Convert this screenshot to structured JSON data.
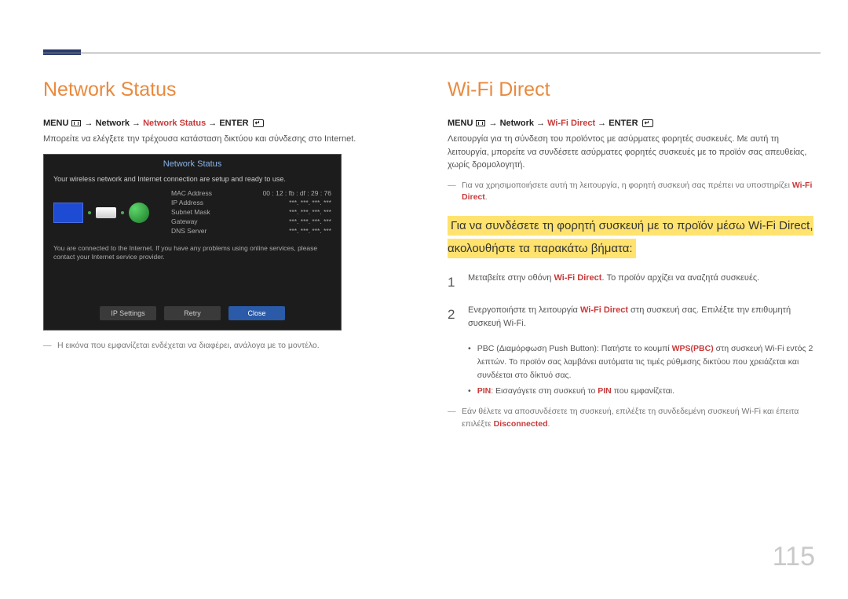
{
  "page_number": "115",
  "left": {
    "title": "Network Status",
    "menu_parts": {
      "p1": "MENU",
      "p2": "Network",
      "p3": "Network Status",
      "p4": "ENTER"
    },
    "body": "Μπορείτε να ελέγξετε την τρέχουσα κατάσταση δικτύου και σύνδεσης στο Internet.",
    "note": "Η εικόνα που εμφανίζεται ενδέχεται να διαφέρει, ανάλογα με το μοντέλο.",
    "ss": {
      "title": "Network Status",
      "msg": "Your wireless network and Internet connection are setup and ready to use.",
      "rows": {
        "r1": {
          "k": "MAC Address",
          "v": "00 : 12 : fb : df : 29 : 76"
        },
        "r2": {
          "k": "IP Address",
          "v": "***. ***. ***. ***"
        },
        "r3": {
          "k": "Subnet Mask",
          "v": "***. ***. ***. ***"
        },
        "r4": {
          "k": "Gateway",
          "v": "***. ***. ***. ***"
        },
        "r5": {
          "k": "DNS Server",
          "v": "***. ***. ***. ***"
        }
      },
      "footer": "You are connected to the Internet. If you have any problems using online services, please contact your Internet service provider.",
      "buttons": {
        "b1": "IP Settings",
        "b2": "Retry",
        "b3": "Close"
      }
    }
  },
  "right": {
    "title": "Wi-Fi Direct",
    "menu_parts": {
      "p1": "MENU",
      "p2": "Network",
      "p3": "Wi-Fi Direct",
      "p4": "ENTER"
    },
    "body": "Λειτουργία για τη σύνδεση του προϊόντος με ασύρματες φορητές συσκευές. Με αυτή τη λειτουργία, μπορείτε να συνδέσετε ασύρματες φορητές συσκευές με το προϊόν σας απευθείας, χωρίς δρομολογητή.",
    "note1_a": "Για να χρησιμοποιήσετε αυτή τη λειτουργία, η φορητή συσκευή σας πρέπει να υποστηρίζει ",
    "note1_b": "Wi-Fi Direct",
    "sub_heading": "Για να συνδέσετε τη φορητή συσκευή με το προϊόν μέσω Wi-Fi Direct, ακολουθήστε τα παρακάτω βήματα:",
    "step1_a": "Μεταβείτε στην οθόνη ",
    "step1_b": "Wi-Fi Direct",
    "step1_c": ". Το προϊόν αρχίζει να αναζητά συσκευές.",
    "step2_a": "Ενεργοποιήστε τη λειτουργία ",
    "step2_b": "Wi-Fi Direct",
    "step2_c": " στη συσκευή σας. Επιλέξτε την επιθυμητή συσκευή Wi-Fi.",
    "bullet1_a": "PBC (Διαμόρφωση Push Button): Πατήστε το κουμπί ",
    "bullet1_b": "WPS(PBC)",
    "bullet1_c": " στη συσκευή Wi-Fi εντός 2 λεπτών. Το προϊόν σας λαμβάνει αυτόματα τις τιμές ρύθμισης δικτύου που χρειάζεται και συνδέεται στο δίκτυό σας.",
    "bullet2_a": "PIN",
    "bullet2_b": ": Εισαγάγετε στη συσκευή το ",
    "bullet2_c": "PIN",
    "bullet2_d": " που εμφανίζεται.",
    "note2_a": "Εάν θέλετε να αποσυνδέσετε τη συσκευή, επιλέξτε τη συνδεδεμένη συσκευή Wi-Fi και έπειτα επιλέξτε ",
    "note2_b": "Disconnected"
  }
}
